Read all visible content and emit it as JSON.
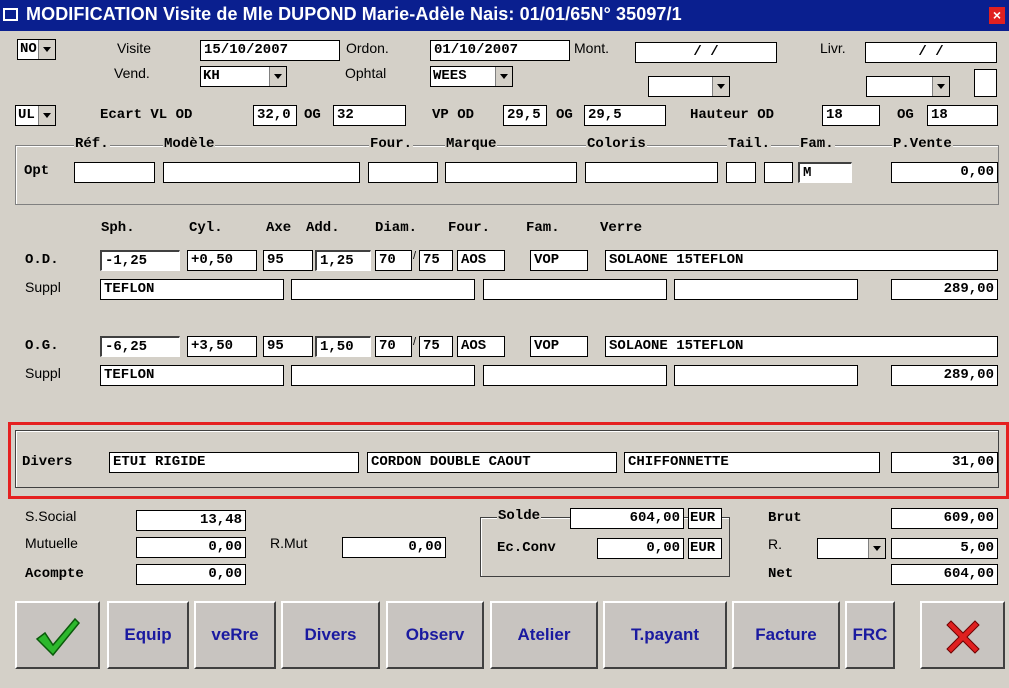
{
  "window": {
    "title": "MODIFICATION  Visite de Mle DUPOND Marie-Adèle  Nais: 01/01/65N° 35097/1",
    "close_label": "×"
  },
  "header": {
    "type_value": "NO",
    "visite_label": "Visite",
    "visite_value": "15/10/2007",
    "ordon_label": "Ordon.",
    "ordon_value": "01/10/2007",
    "mont_label": "Mont.",
    "mont_value": "/  /",
    "livr_label": "Livr.",
    "livr_value": "/  /",
    "vend_label": "Vend.",
    "vend_value": "KH",
    "ophtal_label": "Ophtal",
    "ophtal_value": "WEES",
    "combo3_value": "",
    "combo4_value": ""
  },
  "ecart": {
    "mode_value": "UL",
    "ecart_label": "Ecart VL OD",
    "ecart_od": "32,0",
    "og_label": "OG",
    "ecart_og": "32",
    "vp_label": "VP OD",
    "vp_od": "29,5",
    "vp_og_label": "OG",
    "vp_og": "29,5",
    "hauteur_label": "Hauteur OD",
    "hauteur_od": "18",
    "hauteur_og_label": "OG",
    "hauteur_og": "18"
  },
  "monture": {
    "labels": {
      "ref": "Réf.",
      "modele": "Modèle",
      "four": "Four.",
      "marque": "Marque",
      "coloris": "Coloris",
      "tail": "Tail.",
      "fam": "Fam.",
      "pvente": "P.Vente"
    },
    "row_label": "Opt",
    "fam_value": "M",
    "pvente_value": "0,00"
  },
  "verres": {
    "headers": {
      "sph": "Sph.",
      "cyl": "Cyl.",
      "axe": "Axe",
      "add": "Add.",
      "diam": "Diam.",
      "four": "Four.",
      "fam": "Fam.",
      "verre": "Verre"
    },
    "od": {
      "label": "O.D.",
      "sph": "-1,25",
      "cyl": "+0,50",
      "axe": "95",
      "add": "1,25",
      "diam1": "70",
      "diam2": "75",
      "four": "AOS",
      "fam": "VOP",
      "verre": "SOLAONE 15TEFLON",
      "suppl_label": "Suppl",
      "suppl1": "TEFLON",
      "price": "289,00"
    },
    "og": {
      "label": "O.G.",
      "sph": "-6,25",
      "cyl": "+3,50",
      "axe": "95",
      "add": "1,50",
      "diam1": "70",
      "diam2": "75",
      "four": "AOS",
      "fam": "VOP",
      "verre": "SOLAONE 15TEFLON",
      "suppl_label": "Suppl",
      "suppl1": "TEFLON",
      "price": "289,00"
    }
  },
  "divers": {
    "label": "Divers",
    "item1": "ETUI RIGIDE",
    "item2": "CORDON DOUBLE CAOUT",
    "item3": "CHIFFONNETTE",
    "price": "31,00"
  },
  "totals": {
    "ssocial_label": "S.Social",
    "ssocial": "13,48",
    "mutuelle_label": "Mutuelle",
    "mutuelle": "0,00",
    "rmut_label": "R.Mut",
    "rmut": "0,00",
    "acompte_label": "Acompte",
    "acompte": "0,00",
    "solde_label": "Solde",
    "solde": "604,00",
    "solde_cur": "EUR",
    "ecconv_label": "Ec.Conv",
    "ecconv": "0,00",
    "ecconv_cur": "EUR",
    "brut_label": "Brut",
    "brut": "609,00",
    "r_label": "R.",
    "r_value": "5,00",
    "net_label": "Net",
    "net": "604,00"
  },
  "buttons": {
    "equip": "Equip",
    "verre": "veRre",
    "divers": "Divers",
    "observ": "Observ",
    "atelier": "Atelier",
    "tpayant": "T.payant",
    "facture": "Facture",
    "frc": "FRC"
  },
  "colors": {
    "titlebar": "#0a1f8f",
    "window_bg": "#d4d0c8",
    "button_text": "#1a1aa0",
    "highlight_border": "#e52020",
    "check": "#2db82d",
    "cancel": "#e02020"
  }
}
